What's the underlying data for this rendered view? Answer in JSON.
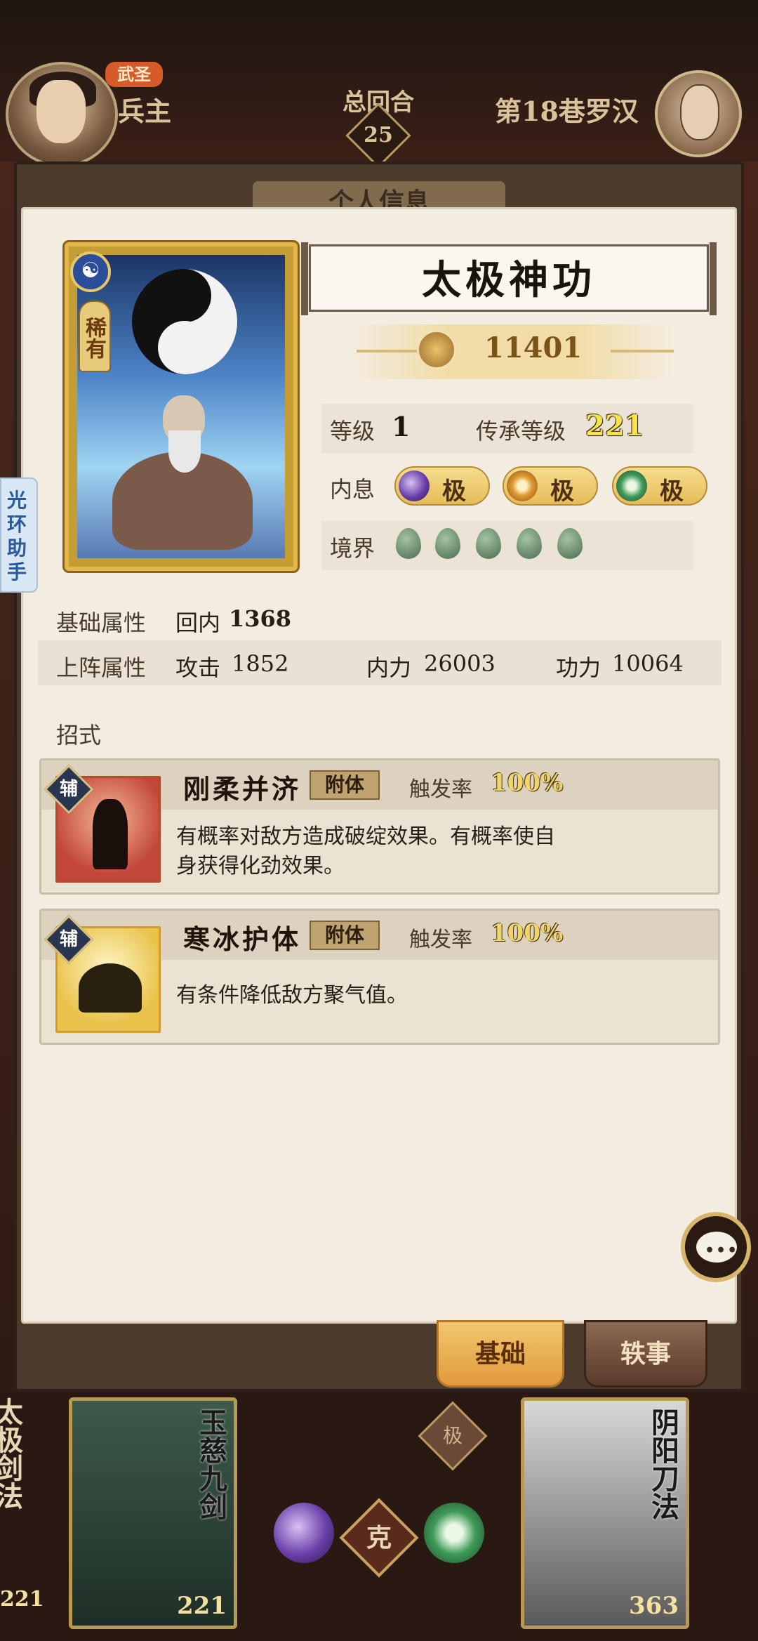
{
  "top": {
    "player_badge": "武圣",
    "player_name": "兵主",
    "round_label": "总回合",
    "round_number": "25",
    "opponent_name": "第18巷罗汉"
  },
  "panel": {
    "tab_title": "个人信息"
  },
  "card": {
    "rarity": "稀有",
    "title": "太极神功",
    "power": "11401"
  },
  "stats": {
    "level_label": "等级",
    "level_value": "1",
    "inherit_label": "传承等级",
    "inherit_value": "221",
    "neixi_label": "内息",
    "neixi": [
      {
        "text": "极",
        "color": "#6a3fa8"
      },
      {
        "text": "极",
        "color": "#e09a34"
      },
      {
        "text": "极",
        "color": "#3f9a5a"
      }
    ],
    "realm_label": "境界",
    "realm_count": 5
  },
  "attributes": {
    "base_label": "基础属性",
    "base_key": "回内",
    "base_value": "1368",
    "battle_label": "上阵属性",
    "attack_key": "攻击",
    "attack_value": "1852",
    "inner_key": "内力",
    "inner_value": "26003",
    "skill_key": "功力",
    "skill_value": "10064"
  },
  "moves": {
    "label": "招式",
    "items": [
      {
        "tag": "辅",
        "name": "刚柔并济",
        "attach": "附体",
        "trigger_label": "触发率",
        "trigger_value": "100%",
        "desc_line1": "有概率对敌方造成破绽效果。有概率使自",
        "desc_line2": "身获得化劲效果。",
        "icon_rarity": "稀有"
      },
      {
        "tag": "辅",
        "name": "寒冰护体",
        "attach": "附体",
        "trigger_label": "触发率",
        "trigger_value": "100%",
        "desc_line1": "有条件降低敌方聚气值。",
        "desc_line2": ""
      }
    ]
  },
  "side_helper": "光环助手",
  "tabs": {
    "basic": "基础",
    "story": "轶事"
  },
  "bottom": {
    "left_stub": "太极剑法",
    "left_stub_level": "221",
    "card1_title": "玉慈九剑",
    "card1_level": "221",
    "center_mark": "克",
    "center_mini": "极",
    "card2_title": "阴阳刀法",
    "card2_level": "363"
  },
  "colors": {
    "accent_gold": "#e4b54a",
    "paper": "#f3ece0",
    "dark_bg": "#3a1f17"
  }
}
